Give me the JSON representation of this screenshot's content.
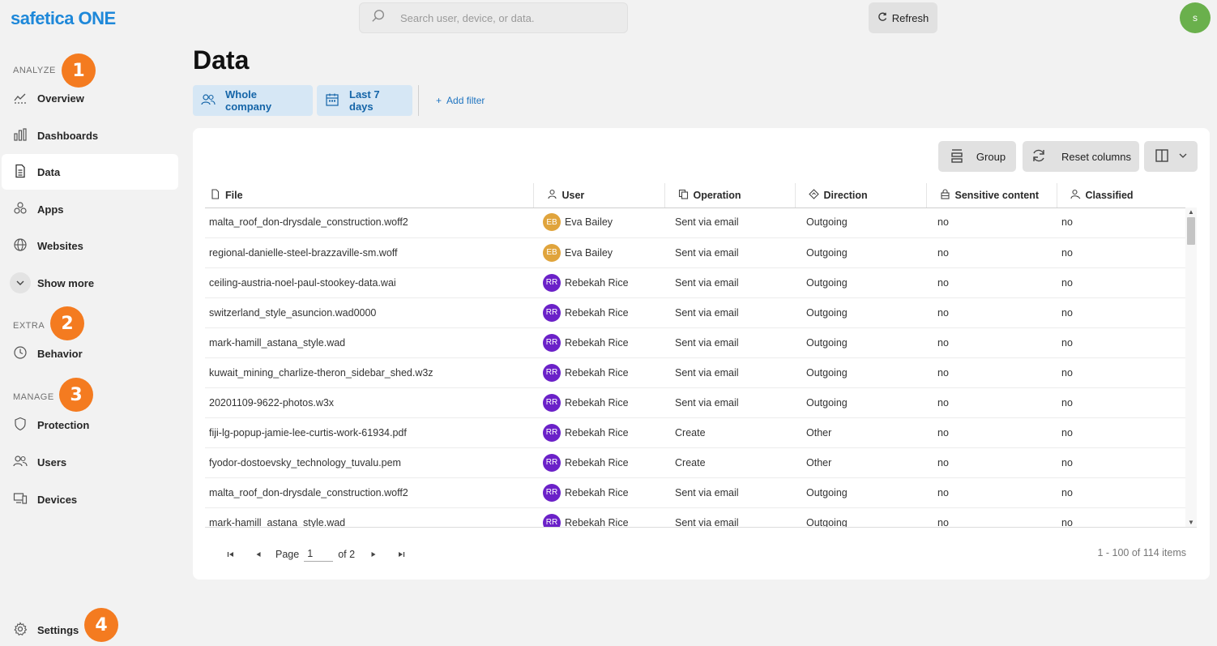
{
  "app": {
    "logo": "safetica ONE",
    "avatar_initial": "s"
  },
  "search": {
    "placeholder": "Search user, device, or data."
  },
  "toolbar": {
    "refresh_label": "Refresh"
  },
  "sidebar": {
    "sections": {
      "analyze": "ANALYZE",
      "extra": "EXTRA",
      "manage": "MANAGE"
    },
    "badges": [
      "1",
      "2",
      "3",
      "4"
    ],
    "items": [
      {
        "label": "Overview",
        "icon": "chart-trend-icon"
      },
      {
        "label": "Dashboards",
        "icon": "bar-chart-icon"
      },
      {
        "label": "Data",
        "icon": "document-icon",
        "active": true
      },
      {
        "label": "Apps",
        "icon": "apps-icon"
      },
      {
        "label": "Websites",
        "icon": "globe-icon"
      },
      {
        "label": "Show more",
        "icon": "chevron-down-icon"
      },
      {
        "label": "Behavior",
        "icon": "clock-icon"
      },
      {
        "label": "Protection",
        "icon": "shield-icon"
      },
      {
        "label": "Users",
        "icon": "users-icon"
      },
      {
        "label": "Devices",
        "icon": "devices-icon"
      },
      {
        "label": "Settings",
        "icon": "gear-icon"
      }
    ]
  },
  "main": {
    "title": "Data",
    "filters": {
      "scope": "Whole company",
      "period": "Last 7 days",
      "add": "Add filter"
    },
    "table_toolbar": {
      "group": "Group",
      "reset": "Reset columns"
    },
    "columns": [
      "File",
      "User",
      "Operation",
      "Direction",
      "Sensitive content",
      "Classified"
    ],
    "rows": [
      {
        "file": "malta_roof_don-drysdale_construction.woff2",
        "initials": "EB",
        "user": "Eva Bailey",
        "operation": "Sent via email",
        "direction": "Outgoing",
        "sensitive": "no",
        "classified": "no"
      },
      {
        "file": "regional-danielle-steel-brazzaville-sm.woff",
        "initials": "EB",
        "user": "Eva Bailey",
        "operation": "Sent via email",
        "direction": "Outgoing",
        "sensitive": "no",
        "classified": "no"
      },
      {
        "file": "ceiling-austria-noel-paul-stookey-data.wai",
        "initials": "RR",
        "user": "Rebekah Rice",
        "operation": "Sent via email",
        "direction": "Outgoing",
        "sensitive": "no",
        "classified": "no"
      },
      {
        "file": "switzerland_style_asuncion.wad0000",
        "initials": "RR",
        "user": "Rebekah Rice",
        "operation": "Sent via email",
        "direction": "Outgoing",
        "sensitive": "no",
        "classified": "no"
      },
      {
        "file": "mark-hamill_astana_style.wad",
        "initials": "RR",
        "user": "Rebekah Rice",
        "operation": "Sent via email",
        "direction": "Outgoing",
        "sensitive": "no",
        "classified": "no"
      },
      {
        "file": "kuwait_mining_charlize-theron_sidebar_shed.w3z",
        "initials": "RR",
        "user": "Rebekah Rice",
        "operation": "Sent via email",
        "direction": "Outgoing",
        "sensitive": "no",
        "classified": "no"
      },
      {
        "file": "20201109-9622-photos.w3x",
        "initials": "RR",
        "user": "Rebekah Rice",
        "operation": "Sent via email",
        "direction": "Outgoing",
        "sensitive": "no",
        "classified": "no"
      },
      {
        "file": "fiji-lg-popup-jamie-lee-curtis-work-61934.pdf",
        "initials": "RR",
        "user": "Rebekah Rice",
        "operation": "Create",
        "direction": "Other",
        "sensitive": "no",
        "classified": "no"
      },
      {
        "file": "fyodor-dostoevsky_technology_tuvalu.pem",
        "initials": "RR",
        "user": "Rebekah Rice",
        "operation": "Create",
        "direction": "Other",
        "sensitive": "no",
        "classified": "no"
      },
      {
        "file": "malta_roof_don-drysdale_construction.woff2",
        "initials": "RR",
        "user": "Rebekah Rice",
        "operation": "Sent via email",
        "direction": "Outgoing",
        "sensitive": "no",
        "classified": "no"
      },
      {
        "file": "mark-hamill_astana_style.wad",
        "initials": "RR",
        "user": "Rebekah Rice",
        "operation": "Sent via email",
        "direction": "Outgoing",
        "sensitive": "no",
        "classified": "no"
      }
    ],
    "avatar_colors": {
      "EB": "#e0a43c",
      "RR": "#6b21c8"
    },
    "pager": {
      "page_label": "Page",
      "page_value": "1",
      "of_label": "of 2",
      "items": "1 - 100 of 114 items"
    }
  }
}
